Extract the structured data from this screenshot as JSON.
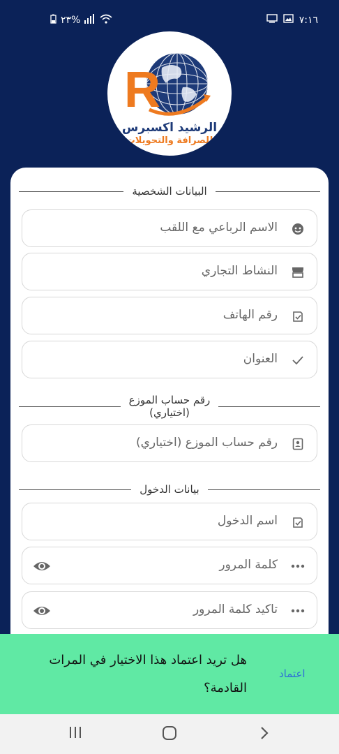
{
  "status_bar": {
    "time": "٧:١٦",
    "battery": "٢٣%"
  },
  "logo": {
    "brand_ar": "الرشيد اكسبرس",
    "tagline_ar": "للصرافة والتحويلات",
    "letter": "R"
  },
  "sections": {
    "personal": "البيانات الشخصية",
    "distributor_line1": "رقم حساب الموزع",
    "distributor_line2": "(اختياري)",
    "login": "بيانات الدخول"
  },
  "fields": {
    "full_name": "الاسم الرباعي مع اللقب",
    "business": "النشاط التجاري",
    "phone": "رقم الهاتف",
    "address": "العنوان",
    "distributor_account": "رقم حساب الموزع (اختياري)",
    "username": "اسم الدخول",
    "password": "كلمة المرور",
    "confirm_password": "تاكيد كلمة المرور"
  },
  "snackbar": {
    "message": "هل تريد اعتماد هذا الاختيار في المرات القادمة؟",
    "action": "اعتماد"
  },
  "colors": {
    "header_bg": "#0b2258",
    "snackbar_bg": "#60e9a4",
    "action": "#2f6fd6",
    "logo_orange": "#ee7a1f",
    "logo_navy": "#1d3a78"
  },
  "icons": [
    "battery-icon",
    "signal-icon",
    "wifi-icon",
    "screen-icon",
    "gallery-icon",
    "face-icon",
    "store-icon",
    "checklist-icon",
    "check-icon",
    "id-card-icon",
    "dots-icon",
    "eye-icon",
    "recents-icon",
    "home-icon",
    "back-icon"
  ]
}
